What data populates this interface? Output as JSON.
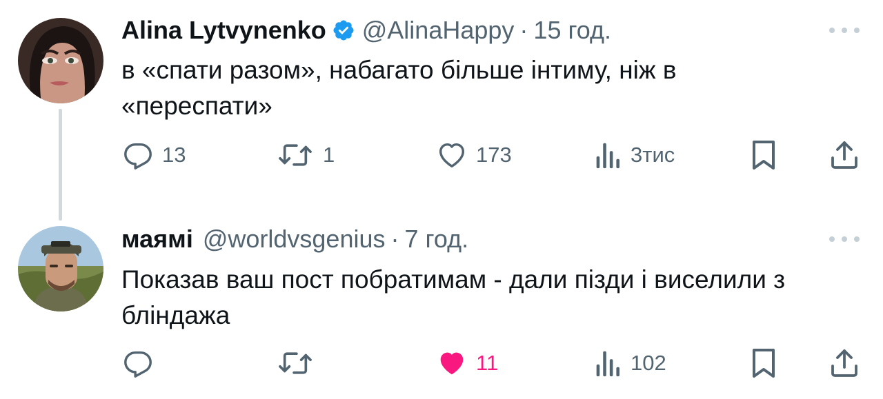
{
  "tweets": [
    {
      "name": "Alina Lytvynenko",
      "handle": "@AlinaHappy",
      "separator": "·",
      "time": "15 год.",
      "text": "в «спати разом», набагато більше інтиму, ніж в «переспати»",
      "verified": true,
      "replies": "13",
      "retweets": "1",
      "likes": "173",
      "views": "3тис"
    },
    {
      "name": "маямі",
      "handle": "@worldvsgenius",
      "separator": "·",
      "time": "7 год.",
      "text": "Показав ваш пост побратимам - дали пізди і виселили з бліндажа",
      "verified": false,
      "replies": "",
      "retweets": "",
      "likes": "11",
      "liked": true,
      "views": "102"
    }
  ],
  "colors": {
    "accent": "#1d9bf0",
    "muted": "#536471",
    "like": "#f91880",
    "thread_line": "#cfd9de"
  },
  "icons": [
    "verified-badge-icon",
    "more-icon",
    "reply-icon",
    "retweet-icon",
    "like-icon",
    "views-icon",
    "bookmark-icon",
    "share-icon"
  ]
}
